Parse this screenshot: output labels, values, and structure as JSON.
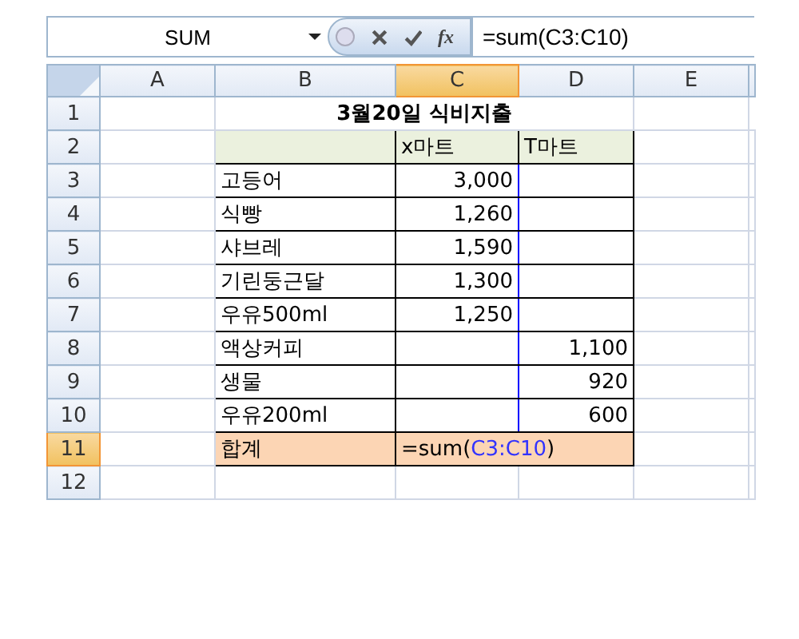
{
  "name_box": "SUM",
  "formula_buttons": [
    {
      "kind": "cancel"
    },
    {
      "kind": "enter"
    },
    {
      "kind": "function",
      "label": "fx"
    }
  ],
  "formula": "=sum(C3:C10)",
  "columns": [
    {
      "label": "A",
      "selected": false
    },
    {
      "label": "B",
      "selected": false
    },
    {
      "label": "C",
      "selected": true
    },
    {
      "label": "D",
      "selected": false
    },
    {
      "label": "E",
      "selected": false
    }
  ],
  "rows": [
    {
      "label": "1",
      "selected": false,
      "kind": "title",
      "title": "3월20일 식비지출"
    },
    {
      "label": "2",
      "selected": false,
      "boxed": true,
      "range": false,
      "kind": "header",
      "cells": {
        "C": "x마트",
        "D": "T마트"
      }
    },
    {
      "label": "3",
      "selected": false,
      "boxed": true,
      "range": true,
      "kind": "item",
      "cells": {
        "B": "고등어",
        "C": "3,000"
      }
    },
    {
      "label": "4",
      "selected": false,
      "boxed": true,
      "range": true,
      "kind": "item",
      "cells": {
        "B": "식빵",
        "C": "1,260"
      }
    },
    {
      "label": "5",
      "selected": false,
      "boxed": true,
      "range": true,
      "kind": "item",
      "cells": {
        "B": "샤브레",
        "C": "1,590"
      }
    },
    {
      "label": "6",
      "selected": false,
      "boxed": true,
      "range": true,
      "kind": "item",
      "cells": {
        "B": "기린둥근달",
        "C": "1,300"
      }
    },
    {
      "label": "7",
      "selected": false,
      "boxed": true,
      "range": true,
      "kind": "item",
      "cells": {
        "B": "우유500ml",
        "C": "1,250"
      }
    },
    {
      "label": "8",
      "selected": false,
      "boxed": true,
      "range": true,
      "kind": "item",
      "cells": {
        "B": "액상커피",
        "D": "1,100"
      }
    },
    {
      "label": "9",
      "selected": false,
      "boxed": true,
      "range": true,
      "kind": "item",
      "cells": {
        "B": "생물",
        "D": "920"
      }
    },
    {
      "label": "10",
      "selected": false,
      "boxed": true,
      "range": true,
      "kind": "item",
      "cells": {
        "B": "우유200ml",
        "D": "600"
      }
    },
    {
      "label": "11",
      "selected": true,
      "boxed": true,
      "range": false,
      "kind": "total",
      "cells": {
        "B": "합계"
      },
      "editing": [
        {
          "text": "=sum("
        },
        {
          "text": "C3:C10",
          "kind": "ref"
        },
        {
          "text": ")"
        }
      ]
    },
    {
      "label": "12",
      "selected": false,
      "boxed": false,
      "range": false,
      "kind": "empty"
    }
  ]
}
